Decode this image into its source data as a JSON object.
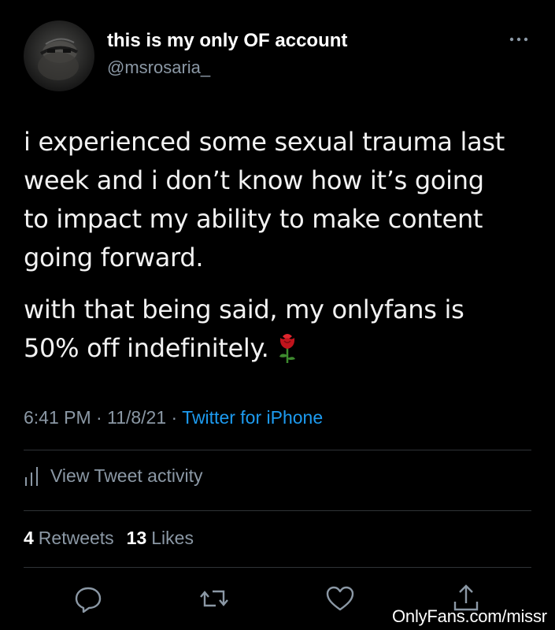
{
  "tweet": {
    "display_name": "this is my only OF account",
    "handle": "@msrosaria_",
    "paragraph_1": "i experienced some sexual trauma last\nweek and i don’t know how it’s going\nto impact my ability to make content\ngoing forward.",
    "paragraph_2": "with that being said, my onlyfans is\n50% off indefinitely.",
    "emoji_icon": "rose-icon",
    "time": "6:41 PM",
    "separator": " · ",
    "date": "11/8/21",
    "source": "Twitter for iPhone"
  },
  "activity": {
    "label": "View Tweet activity",
    "icon": "bar-chart-icon"
  },
  "stats": {
    "retweets_count": "4",
    "retweets_label": "Retweets",
    "likes_count": "13",
    "likes_label": "Likes"
  },
  "actions": {
    "reply_icon": "reply-icon",
    "retweet_icon": "retweet-icon",
    "like_icon": "heart-icon",
    "share_icon": "share-icon",
    "more_icon": "more-dots-icon"
  },
  "watermark": "OnlyFans.com/missr",
  "colors": {
    "background": "#000000",
    "primary_text": "#e7e9ea",
    "secondary_text": "#8b98a5",
    "link": "#1d9bf0",
    "divider": "#2f3336",
    "rose": "#c0141c"
  }
}
